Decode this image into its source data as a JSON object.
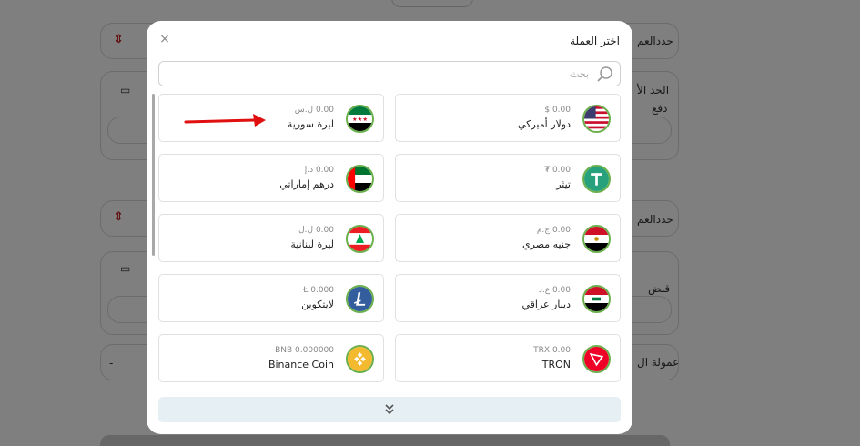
{
  "background": {
    "labels": {
      "select_currency_1": "حددالعم",
      "max_limit": "الحد الأ",
      "pay": "دفع",
      "select_currency_2": "حددالعم",
      "receive": "قبض",
      "fee": "عمولة ال",
      "fee_value": "-"
    }
  },
  "modal": {
    "title": "اختر العملة",
    "close_symbol": "×",
    "search_placeholder": "بحث"
  },
  "currencies": [
    {
      "balance": "0.00 $",
      "name": "دولار أميركي",
      "flag": "us-flag-icon"
    },
    {
      "balance": "0.00 ل.س",
      "name": "ليرة سورية",
      "flag": "syria-flag-icon"
    },
    {
      "balance": "0.00 ₮",
      "name": "تيثر",
      "flag": "tether-icon"
    },
    {
      "balance": "0.00 د.إ",
      "name": "درهم إماراتي",
      "flag": "uae-flag-icon"
    },
    {
      "balance": "0.00 ج.م",
      "name": "جنيه مصري",
      "flag": "egypt-flag-icon"
    },
    {
      "balance": "0.00 ل.ل",
      "name": "ليرة لبنانية",
      "flag": "lebanon-flag-icon"
    },
    {
      "balance": "0.00 ع.د",
      "name": "دينار عراقي",
      "flag": "iraq-flag-icon"
    },
    {
      "balance": "0.000 Ł",
      "name": "لايتكوين",
      "flag": "litecoin-icon"
    },
    {
      "balance": "TRX 0.00",
      "name": "TRON",
      "flag": "tron-icon"
    },
    {
      "balance": "BNB 0.000000",
      "name": "Binance Coin",
      "flag": "bnb-icon"
    }
  ],
  "colors": {
    "accent_border": "#6ab04c",
    "more_bg": "#e6f0f4",
    "annotation_arrow": "#e01010"
  }
}
